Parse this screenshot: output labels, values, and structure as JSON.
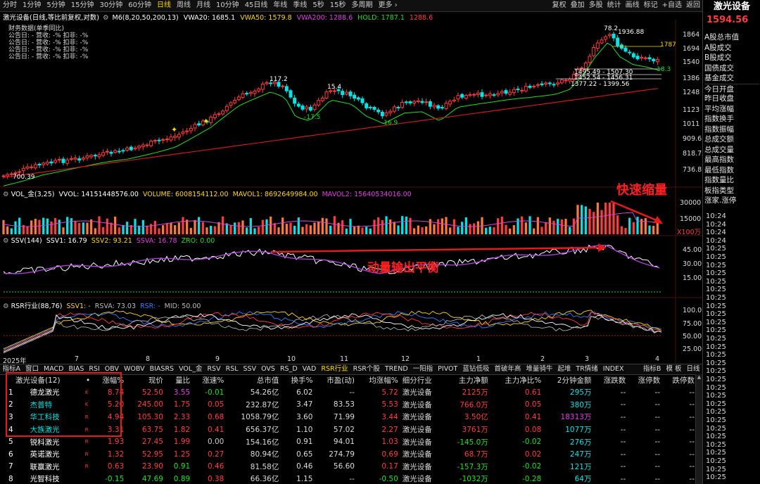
{
  "toolbar": {
    "periods": [
      "分时",
      "1分钟",
      "5分钟",
      "15分钟",
      "30分钟",
      "60分钟",
      "日线",
      "周线",
      "月线",
      "10分钟",
      "45日线",
      "年线",
      "季线",
      "5秒",
      "15秒",
      "多周期",
      "更多 ›"
    ],
    "active_period": "日线",
    "right": [
      "复权",
      "叠加",
      "多股",
      "统计",
      "画线",
      "标记",
      "+自选",
      "返回"
    ]
  },
  "chart_header": {
    "title": "激光设备(日线,等比前复权,对数)",
    "ma_label": "M6(8,20,50,200,13)",
    "vwa20": "VWA20: 1685.1",
    "vwa50": "VWA50: 1579.8",
    "vwa200": "VWA200: 1288.6",
    "hold": "HOLD: 1787.1",
    "val": "1288.6"
  },
  "finance_box": {
    "title": "财务数据(单季同比)",
    "rows": [
      "公告日: -  营收: -%  扣非: -%",
      "公告日: -  营收: -%  扣非: -%",
      "公告日: -  营收: -%  扣非: -%",
      "公告日: -  营收: -%  扣非: -%"
    ]
  },
  "price_axis": [
    "1864",
    "1694",
    "1540",
    "1386",
    "1248",
    "1123",
    "1011",
    "909.6",
    "818.7",
    "736.8"
  ],
  "price_labels": {
    "high": "1936.88",
    "left_low": "700.39",
    "p1": "117.2",
    "p2": "15.4",
    "p3": "-17.5",
    "p4": "-16.9",
    "p5": "78.2",
    "hold": "1787",
    "p6": "-18.3",
    "b1": "1495.49 - 1507.30",
    "b2": "1452.54 - 1456.31",
    "b3": "1377.22 - 1399.56"
  },
  "vol_header": {
    "title": "VOL_金(3,25)",
    "vvol": "VVOL: 14151448576.00",
    "volume": "VOLUME: 6008154112.00",
    "mavol1": "MAVOL1: 8692649984.00",
    "mavol2": "MAVOL2: 15640534016.00"
  },
  "vol_axis": [
    "30000",
    "15000",
    "X100万"
  ],
  "ssv_header": {
    "title": "SSV(144)",
    "ssv1": "SSV1: 16.79",
    "ssv2": "SSV2: 93.21",
    "ssva": "SSVA: 16.78",
    "zro": "ZRO: 0.00"
  },
  "ssv_axis": [
    "45.00",
    "30.00",
    "15.00"
  ],
  "rsr_header": {
    "title": "RSR行业(88,76)",
    "ssv1": "SSV1: -",
    "rsva": "RSVA: 73.03",
    "rsr": "RSR: -",
    "mid": "MID: 50.00"
  },
  "rsr_axis": [
    "100.0",
    "75.00",
    "50.00",
    "25.00"
  ],
  "date_axis": {
    "year": "2025年",
    "months": [
      "7",
      "8",
      "9",
      "10",
      "11",
      "12",
      "1",
      "2",
      "3",
      "4"
    ]
  },
  "annotations": {
    "fast_shrink": "快速缩量",
    "momentum": "动量输出平衡"
  },
  "tabs": [
    "指标A",
    "窗口",
    "MACD",
    "BIAS",
    "RSI",
    "OBV",
    "WOBV",
    "BIASRS",
    "VOL_金",
    "RSV",
    "RSL",
    "SSV",
    "OVS",
    "RS_D",
    "VAD",
    "RSR行业",
    "RSR个股",
    "TREND",
    "一阳指",
    "PIVOT",
    "蓝钻低吸",
    "首破年高",
    "堆量骑牛",
    "起堆",
    "TR情绪",
    "INDEX"
  ],
  "active_tab": "RSR行业",
  "tabs_right": [
    "指标B",
    "模 板",
    "日线"
  ],
  "table": {
    "headers": [
      "激光设备(12)",
      "•",
      "涨幅%",
      "现价",
      "量比",
      "涨速%",
      "总市值",
      "换手%",
      "市盈(动)",
      "均涨幅%",
      "细分行业",
      "主力净额",
      "主力净比%",
      "2分钟金额",
      "涨跌数",
      "涨停数",
      "跌停数"
    ],
    "rows": [
      [
        "1",
        "德龙激光",
        "K",
        "8.74",
        "52.50",
        "3.55",
        "-0.01",
        "54.26亿",
        "6.02",
        "--",
        "5.72",
        "激光设备",
        "2125万",
        "0.61",
        "295万",
        "--",
        "--",
        "--"
      ],
      [
        "2",
        "杰普特",
        "K",
        "5.20",
        "245.00",
        "1.75",
        "0.05",
        "232.87亿",
        "3.47",
        "83.53",
        "5.53",
        "激光设备",
        "766.0万",
        "0.05",
        "380万",
        "--",
        "--",
        "--"
      ],
      [
        "3",
        "华工科技",
        "R",
        "4.94",
        "105.30",
        "2.33",
        "0.68",
        "1058.79亿",
        "3.60",
        "71.99",
        "3.44",
        "激光设备",
        "3.50亿",
        "0.41",
        "18313万",
        "--",
        "--",
        "--"
      ],
      [
        "4",
        "大族激光",
        "R",
        "3.31",
        "63.75",
        "1.82",
        "0.41",
        "656.37亿",
        "1.10",
        "57.02",
        "2.27",
        "激光设备",
        "3761万",
        "0.08",
        "1077万",
        "--",
        "--",
        "--"
      ],
      [
        "5",
        "锐科激光",
        "R",
        "1.93",
        "27.45",
        "1.99",
        "0.00",
        "154.16亿",
        "0.91",
        "94.01",
        "1.03",
        "激光设备",
        "-145.0万",
        "-0.02",
        "276万",
        "--",
        "--",
        "--"
      ],
      [
        "6",
        "英诺激光",
        "R",
        "1.32",
        "52.95",
        "1.25",
        "0.27",
        "80.94亿",
        "0.65",
        "274.79",
        "0.69",
        "激光设备",
        "68.7万",
        "0.02",
        "247万",
        "--",
        "--",
        "--"
      ],
      [
        "7",
        "联赢激光",
        "R",
        "0.63",
        "23.90",
        "0.91",
        "0.46",
        "81.58亿",
        "0.46",
        "56.60",
        "0.17",
        "激光设备",
        "-157.3万",
        "-0.02",
        "121万",
        "--",
        "--",
        "--"
      ],
      [
        "8",
        "光智科技",
        "",
        "-0.15",
        "47.69",
        "0.89",
        "0.38",
        "66.36亿",
        "1.15",
        "--",
        "-0.50",
        "激光设备",
        "-1032万",
        "-0.28",
        "64万",
        "--",
        "--",
        "--"
      ]
    ]
  },
  "right_panel": {
    "title": "激光设备",
    "price": "1594.56",
    "items": [
      "A股总市值",
      "A股成交",
      "B股成交",
      "国债成交",
      "基金成交",
      "今日开盘",
      "昨日收盘",
      "平均涨幅",
      "指数换手",
      "指数振幅",
      "总成交额",
      "总成交量",
      "最高指数",
      "最低指数",
      "指数量比",
      "板指类型",
      "涨家.涨停"
    ],
    "times": [
      "10:24",
      "10:24",
      "10:24",
      "10:24",
      "10:25",
      "10:25",
      "10:25",
      "10:25",
      "10:25",
      "10:25",
      "10:25",
      "10:25",
      "10:25",
      "10:25",
      "10:25",
      "10:25",
      "10:25",
      "10:25",
      "10:25",
      "10:25",
      "10:25",
      "10:25",
      "10:25",
      "10:25",
      "10:25",
      "10:25",
      "10:25",
      "10:25",
      "10:25",
      "10:25",
      "10:25",
      "10:25",
      "10:25"
    ]
  }
}
